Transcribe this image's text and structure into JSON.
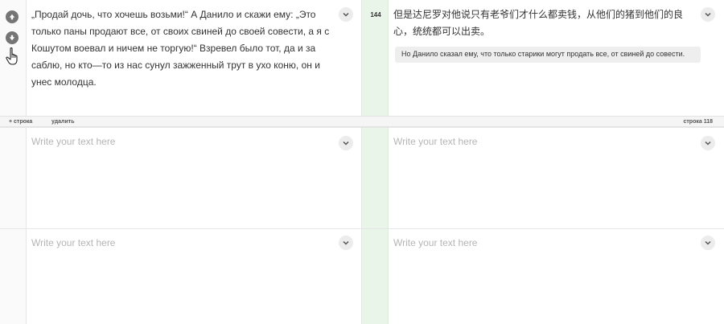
{
  "segment1": {
    "source_text": "„Продай дочь, что хочешь возьми!“ А Данило и скажи ему: „Это только паны продают все, от своих свиней до своей совести, а я с Кошутом воевал и ничем не торгую!“ Взревел было тот, да и за саблю, но кто—то из нас сунул зажженный трут в ухо коню, он и унес молодца.",
    "line_number": "144",
    "target_text": "但是达尼罗对他说只有老爷们才什么都卖钱，从他们的猪到他们的良心，统统都可以出卖。",
    "suggestion": "Но Данило сказал ему, что только старики могут продать все, от свиней до совести."
  },
  "row_actions": {
    "add_row": "+ строка",
    "delete": "удалить",
    "row_label": "строка 118"
  },
  "segment2": {
    "source_placeholder": "Write your text here",
    "target_placeholder": "Write your text here"
  },
  "segment3": {
    "source_placeholder": "Write your text here",
    "target_placeholder": "Write your text here"
  },
  "icons": {
    "move_up": "arrow-up-icon",
    "move_down": "arrow-down-icon",
    "pointer": "hand-pointer-icon",
    "expand": "chevron-down-icon"
  },
  "colors": {
    "gutter_green": "#e9f5e9",
    "placeholder": "#b5b5b5",
    "suggestion_bg": "#eeeeee"
  }
}
